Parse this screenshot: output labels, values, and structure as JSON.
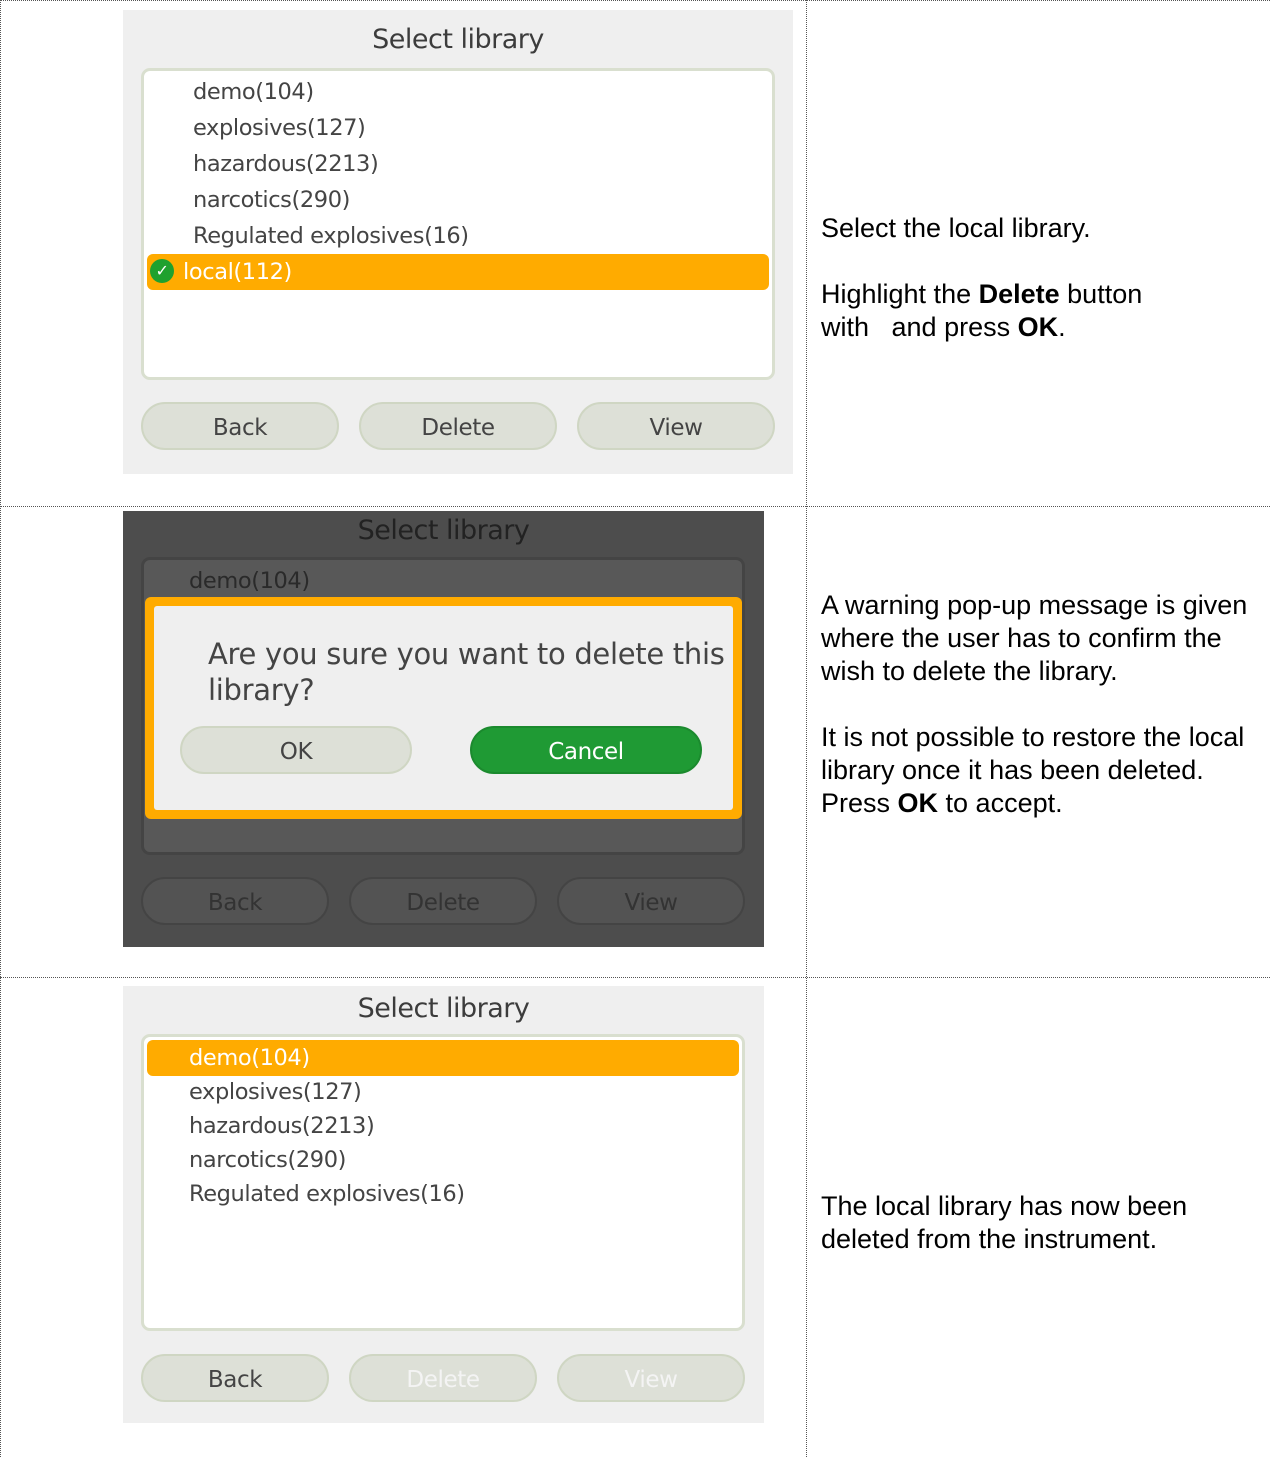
{
  "rows": [
    {
      "screen": {
        "title": "Select library",
        "items": [
          "demo(104)",
          "explosives(127)",
          "hazardous(2213)",
          "narcotics(290)",
          "Regulated explosives(16)",
          "local(112)"
        ],
        "selected_item": "local(112)",
        "buttons": {
          "back": "Back",
          "delete": "Delete",
          "view": "View"
        }
      },
      "text": {
        "line1": "Select the local library.",
        "line2_pre": "Highlight the ",
        "line2_bold": "Delete",
        "line2_post": " button",
        "line3_pre": "with   and press ",
        "line3_bold": "OK",
        "line3_post": "."
      }
    },
    {
      "screen": {
        "title": "Select library",
        "items": [
          "demo(104)"
        ],
        "dialog": {
          "message": "Are you sure you want to delete this library?",
          "ok": "OK",
          "cancel": "Cancel"
        },
        "buttons": {
          "back": "Back",
          "delete": "Delete",
          "view": "View"
        }
      },
      "text": {
        "para1": "A warning pop-up message is given where the user has to confirm the wish to delete the library.",
        "para2": "It is not possible to restore the local library once it has been deleted.",
        "press_pre": "Press ",
        "press_bold": "OK",
        "press_post": " to accept."
      }
    },
    {
      "screen": {
        "title": "Select library",
        "items": [
          "demo(104)",
          "explosives(127)",
          "hazardous(2213)",
          "narcotics(290)",
          "Regulated explosives(16)"
        ],
        "selected_item": "demo(104)",
        "buttons": {
          "back": "Back",
          "delete": "Delete",
          "view": "View"
        }
      },
      "text": {
        "para1": "The local library has now been deleted from the instrument."
      }
    }
  ],
  "colors": {
    "highlight": "#ffab00",
    "confirm_green": "#1f9a34",
    "check_green": "#1fa12e"
  },
  "icons": {
    "selected_marker": "check-circle-icon"
  }
}
